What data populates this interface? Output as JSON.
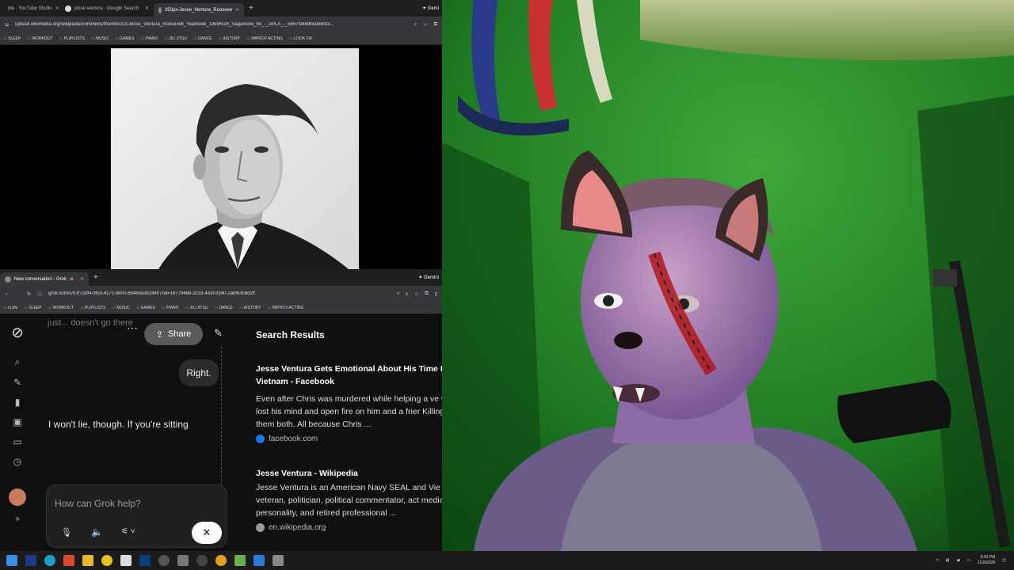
{
  "top_browser": {
    "tabs": [
      {
        "label": "ide - YouTube Studio"
      },
      {
        "label": "jesse ventura - Google Search"
      },
      {
        "label": "250px-Jesse_Ventura_Rooseve"
      }
    ],
    "gemini_label": "Gemi",
    "url": "upload.wikimedia.org/wikipedia/commons/thumb/c/c1/Jesse_Ventura_Roosevelt_Yearbook_1969%28_Sagamore_69_-_DPLA_-_5b67f348dbed8efd3...",
    "bookmarks": [
      "SLEEP",
      "WORKOUT",
      "PLAYLISTS",
      "MUSIC",
      "GAMES",
      "PIANO",
      "JIU JITSU",
      "DANCE",
      "AISTORY",
      "IMPROV ACTING",
      "LOOK FIX"
    ]
  },
  "bottom_browser": {
    "tabs": [
      {
        "label": "New conversation - Grok"
      }
    ],
    "gemini_label": "Gemini",
    "url": "grok.com/c/03f72df4-9fcd-417c-9800-6946da3618407rid=1677948b-2c33-4e3f-9340-2a6f63cbd2ff",
    "bookmarks": [
      "LLMs",
      "SLEEP",
      "WORKOUT",
      "PLAYLISTS",
      "MUSIC",
      "GAMES",
      "PIANO",
      "JIU JITSU",
      "DANCE",
      "AISTORY",
      "IMPROV ACTING"
    ]
  },
  "grok": {
    "faded_text": "just... doesn't go there",
    "share_label": "Share",
    "user_message": "Right.",
    "assistant_text": "I won't lie, though. If you're sitting",
    "prompt_placeholder": "How can Grok help?",
    "results_title": "Search Results",
    "results": [
      {
        "title": "Jesse Ventura Gets Emotional About His Time In Vietnam - Facebook",
        "snippet": "Even after Chris was murdered while helping a ve who lost his mind and open fire on him and a frier Killing them both. All because Chris ...",
        "source": "facebook.com",
        "source_color": "#1877f2"
      },
      {
        "title": "Jesse Ventura - Wikipedia",
        "snippet": "Jesse Ventura is an American Navy SEAL and Vie war veteran, politician, political commentator, act media personality, and retired professional ...",
        "source": "en.wikipedia.org",
        "source_color": "#999999"
      }
    ]
  },
  "taskbar": {
    "time": "9:20 PM",
    "date": "1/18/2026"
  }
}
